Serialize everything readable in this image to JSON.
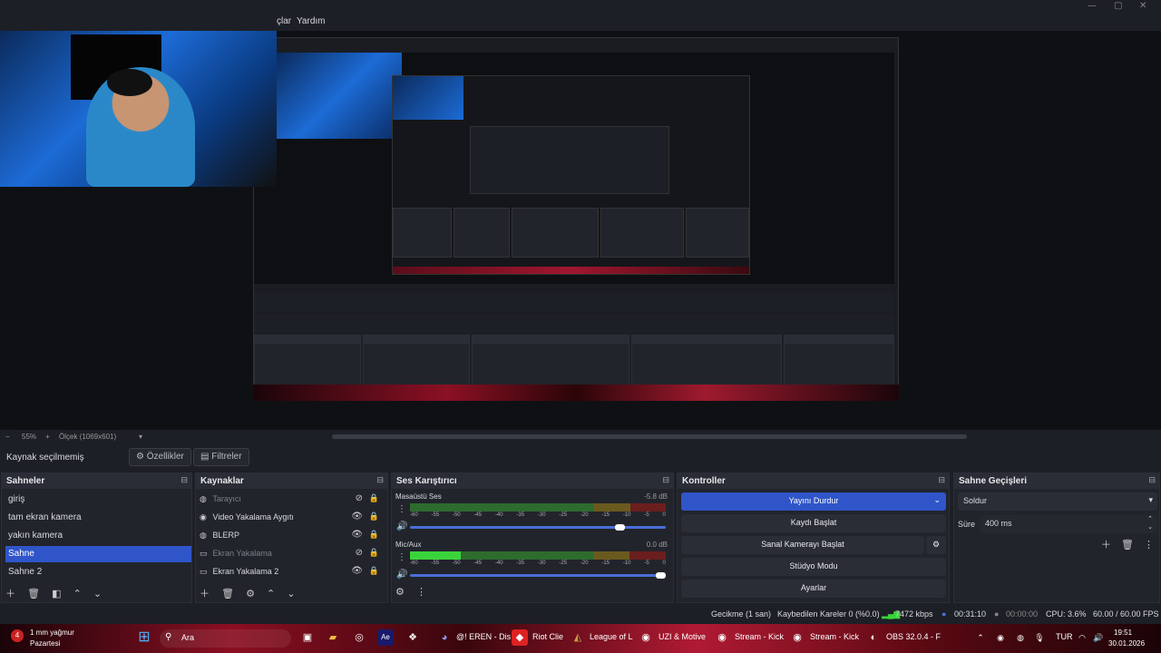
{
  "menubar": {
    "partial_item": "çlar",
    "help": "Yardım"
  },
  "zoom": {
    "minus": "−",
    "percent": "55%",
    "plus": "+",
    "scale": "Ölçek (1069x601)"
  },
  "context": {
    "label": "Kaynak seçilmemiş",
    "properties": "Özellikler",
    "filters": "Filtreler"
  },
  "scenes": {
    "title": "Sahneler",
    "items": [
      "giriş",
      "tam ekran kamera",
      "yakın kamera",
      "Sahne",
      "Sahne 2"
    ],
    "selected": "Sahne"
  },
  "sources": {
    "title": "Kaynaklar",
    "items": [
      {
        "label": "Tarayıcı",
        "visible": false
      },
      {
        "label": "Video Yakalama Aygıtı",
        "visible": true
      },
      {
        "label": "BLERP",
        "visible": true
      },
      {
        "label": "Ekran Yakalama",
        "visible": false
      },
      {
        "label": "Ekran Yakalama 2",
        "visible": true
      }
    ]
  },
  "mixer": {
    "title": "Ses Karıştırıcı",
    "channels": [
      {
        "name": "Masaüstü Ses",
        "db": "-5.8 dB",
        "level": 0.0,
        "fader": 0.84
      },
      {
        "name": "Mic/Aux",
        "db": "0.0 dB",
        "level": 0.2,
        "fader": 1.0
      }
    ],
    "ticks": [
      "-60",
      "-55",
      "-50",
      "-45",
      "-40",
      "-35",
      "-30",
      "-25",
      "-20",
      "-15",
      "-10",
      "-5",
      "0"
    ]
  },
  "controls": {
    "title": "Kontroller",
    "stop_stream": "Yayını Durdur",
    "start_record": "Kaydı Başlat",
    "virtual_cam": "Sanal Kamerayı Başlat",
    "studio_mode": "Stüdyo Modu",
    "settings": "Ayarlar"
  },
  "transitions": {
    "title": "Sahne Geçişleri",
    "selected": "Soldur",
    "duration_label": "Süre",
    "duration_value": "400 ms"
  },
  "status": {
    "delay": "Gecikme (1 san)",
    "dropped": "Kaybedilen Kareler 0 (%0.0)",
    "bitrate": "7472 kbps",
    "stream_time": "00:31:10",
    "record_time": "00:00:00",
    "cpu": "CPU: 3.6%",
    "fps": "60.00 / 60.00 FPS"
  },
  "taskbar": {
    "weather_temp": "1 mm yağmur",
    "weather_day": "Pazartesi",
    "search": "Ara",
    "apps": [
      "@! EREN - Dis",
      "Riot Clie",
      "League of L",
      "UZI & Motive",
      "Stream - Kick",
      "Stream - Kick",
      "OBS 32.0.4 - F"
    ],
    "language": "TUR",
    "time": "19:51",
    "date": "30.01.2026",
    "notif_count": "4"
  },
  "colors": {
    "accent": "#2f55c9",
    "meter_green": "#3ad43a",
    "meter_yellow": "#c7a12a",
    "meter_red": "#b02a2a"
  }
}
